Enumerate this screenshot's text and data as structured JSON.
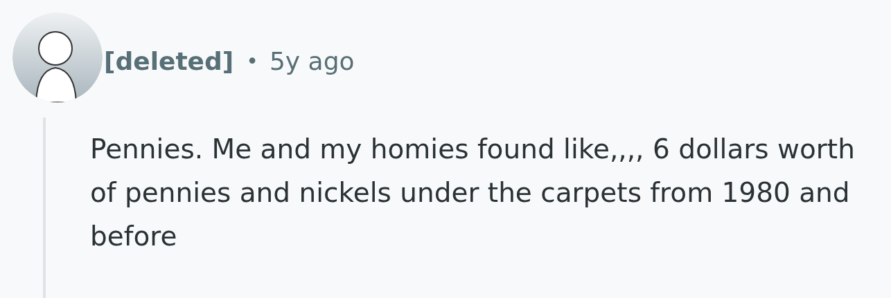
{
  "comment": {
    "author": "[deleted]",
    "separator": "•",
    "age": "5y ago",
    "body": "Pennies. Me and my homies found like,,,, 6 dollars worth of pennies and nickels under the carpets from 1980 and before"
  }
}
